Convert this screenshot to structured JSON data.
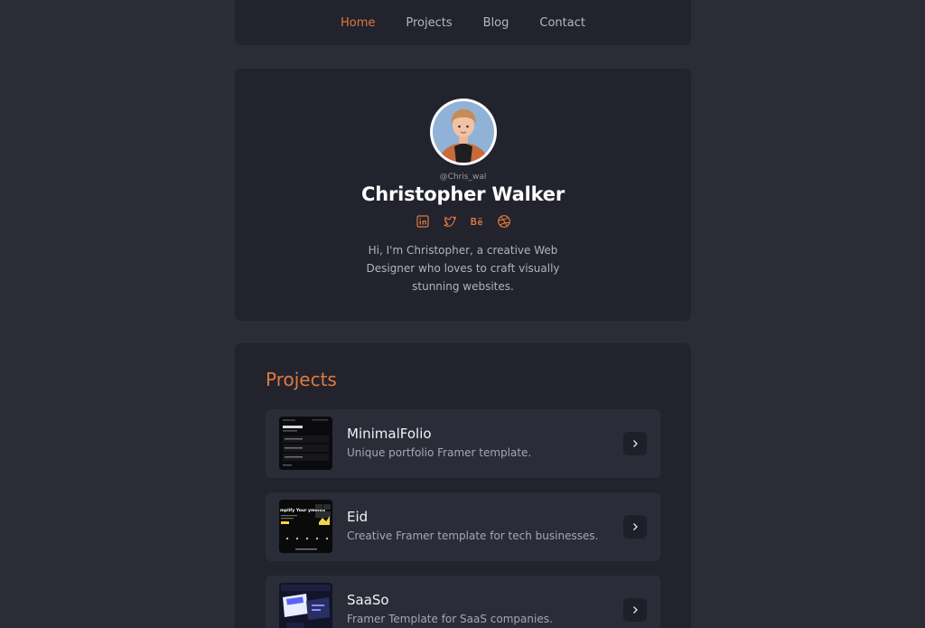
{
  "nav": {
    "items": [
      {
        "label": "Home",
        "active": true
      },
      {
        "label": "Projects",
        "active": false
      },
      {
        "label": "Blog",
        "active": false
      },
      {
        "label": "Contact",
        "active": false
      }
    ]
  },
  "profile": {
    "handle": "@Chris_wal",
    "name": "Christopher Walker",
    "socials": [
      "linkedin-icon",
      "twitter-icon",
      "behance-icon",
      "dribbble-icon"
    ],
    "bio": "Hi, I'm Christopher, a creative Web Designer who loves to craft visually stunning websites."
  },
  "projects": {
    "heading": "Projects",
    "items": [
      {
        "title": "MinimalFolio",
        "description": "Unique portfolio Framer template."
      },
      {
        "title": "Eid",
        "description": "Creative Framer template for tech businesses.",
        "thumb_text": "mplify Your yments"
      },
      {
        "title": "SaaSo",
        "description": "Framer Template for SaaS companies."
      }
    ]
  },
  "colors": {
    "accent": "#e07a3f",
    "background": "#2a2c36",
    "panel": "#22232d",
    "card": "#2a2c37"
  }
}
